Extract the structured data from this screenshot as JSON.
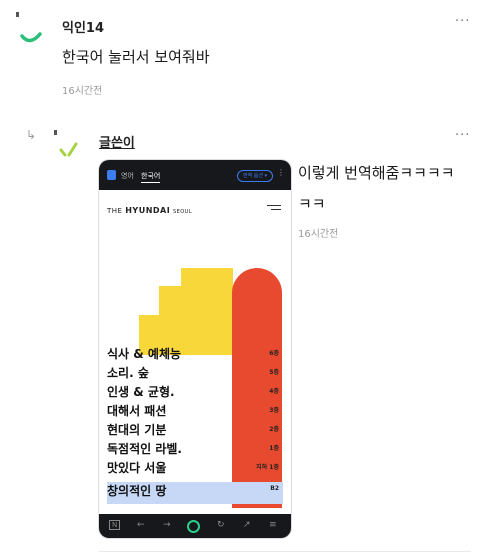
{
  "comments": [
    {
      "author": "익인14",
      "text": "한국어 눌러서 보여줘바",
      "time": "16시간전",
      "more": "···"
    },
    {
      "author": "글쓴이",
      "text": "이렇게 번역해줌ㅋㅋㅋㅋㅋㅋ",
      "time": "16시간전",
      "more": "···",
      "reply_arrow": "↳"
    }
  ],
  "screenshot": {
    "tabs": [
      "영어",
      "한국어"
    ],
    "translate_pill": "번역 옵션 ▾",
    "top_more": "⋮",
    "brand_prefix": "THE",
    "brand_name": "HYUNDAI",
    "brand_city": "SEOUL",
    "floors": [
      {
        "name": "식사 & 예체능",
        "level": "6층"
      },
      {
        "name": "소리. 숲",
        "level": "5층"
      },
      {
        "name": "인생 & 균형.",
        "level": "4층"
      },
      {
        "name": "대해서 패션",
        "level": "3층"
      },
      {
        "name": "현대의 기분",
        "level": "2층"
      },
      {
        "name": "독점적인 라벨.",
        "level": "1층"
      },
      {
        "name": "맛있다 서울",
        "level": "지하 1층"
      },
      {
        "name": "창의적인 땅",
        "level": "B2"
      }
    ],
    "nav_icons": [
      "N",
      "←",
      "→",
      "↻",
      "↗",
      "≡"
    ],
    "colors": {
      "yellow": "#f7d73a",
      "red": "#e84a2f",
      "highlight": "#c6d8f6",
      "dark": "#16181c"
    }
  }
}
